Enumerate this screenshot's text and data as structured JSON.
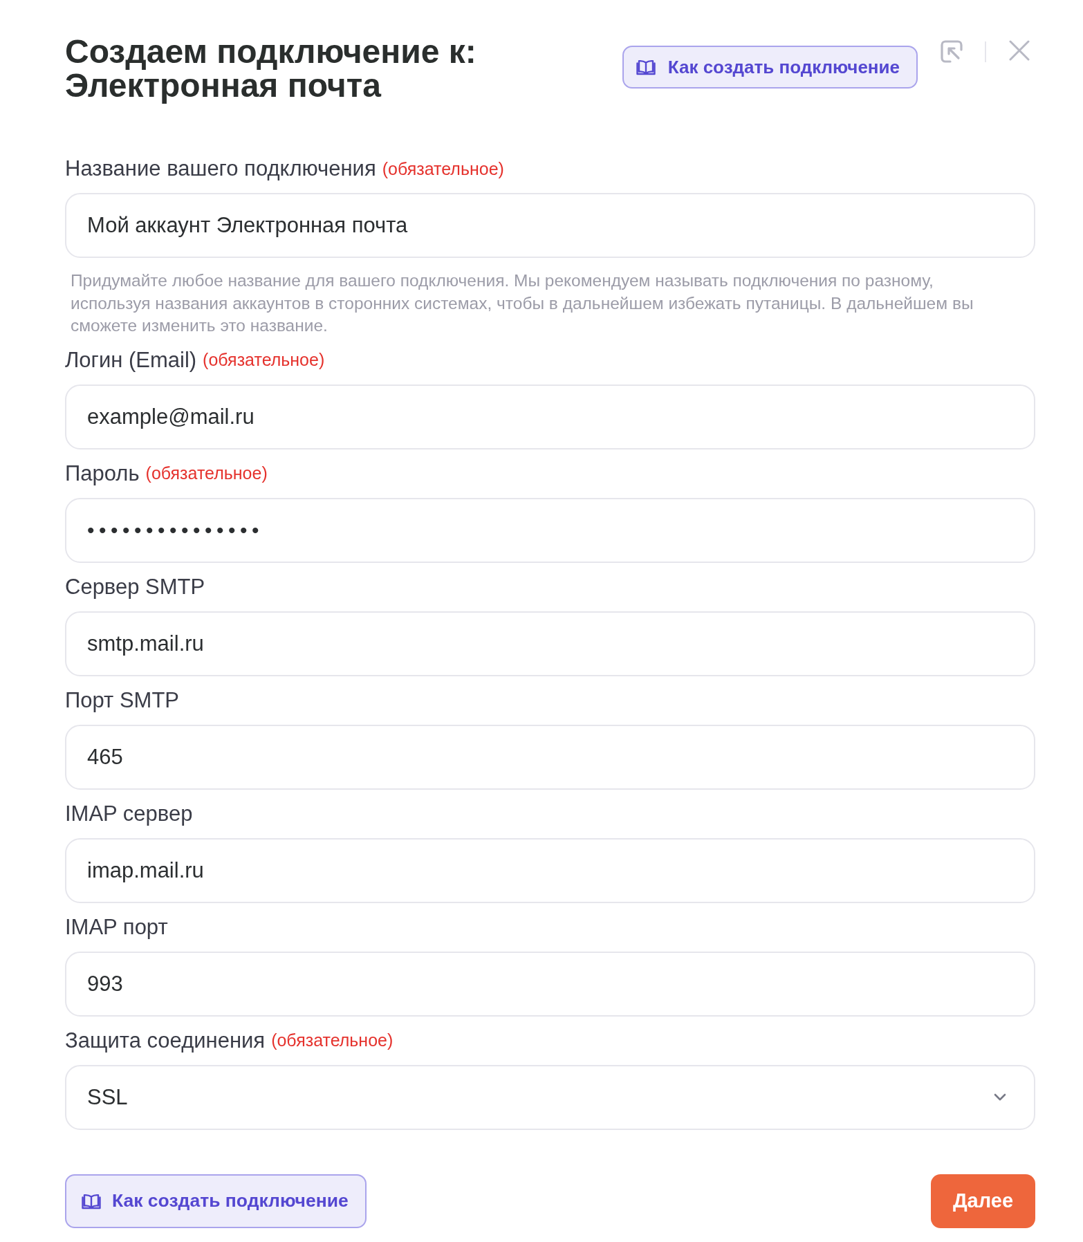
{
  "dialog": {
    "title": "Создаем подключение к: Электронная почта",
    "help_button": {
      "label": "Как создать подключение"
    }
  },
  "fields": [
    {
      "kind": "text",
      "label": "Название вашего подключения",
      "required_note": "(обязательное)",
      "value": "Мой аккаунт Электронная почта",
      "hint": "Придумайте любое название для вашего подключения. Мы рекомендуем называть подключения по разному, используя названия аккаунтов в сторонних системах, чтобы в дальнейшем избежать путаницы. В дальнейшем вы сможете изменить это название."
    },
    {
      "kind": "text",
      "label": "Логин (Email)",
      "required_note": "(обязательное)",
      "value": "example@mail.ru"
    },
    {
      "kind": "password",
      "label": "Пароль",
      "required_note": "(обязательное)",
      "value": "•••••••••••••••"
    },
    {
      "kind": "text",
      "label": "Сервер SMTP",
      "value": "smtp.mail.ru"
    },
    {
      "kind": "text",
      "label": "Порт SMTP",
      "value": "465"
    },
    {
      "kind": "text",
      "label": "IMAP сервер",
      "value": "imap.mail.ru"
    },
    {
      "kind": "text",
      "label": "IMAP порт",
      "value": "993"
    },
    {
      "kind": "select",
      "label": "Защита соединения",
      "required_note": "(обязательное)",
      "value": "SSL"
    }
  ],
  "footer": {
    "help_button": {
      "label": "Как создать подключение"
    },
    "next_button": {
      "label": "Далее"
    }
  }
}
